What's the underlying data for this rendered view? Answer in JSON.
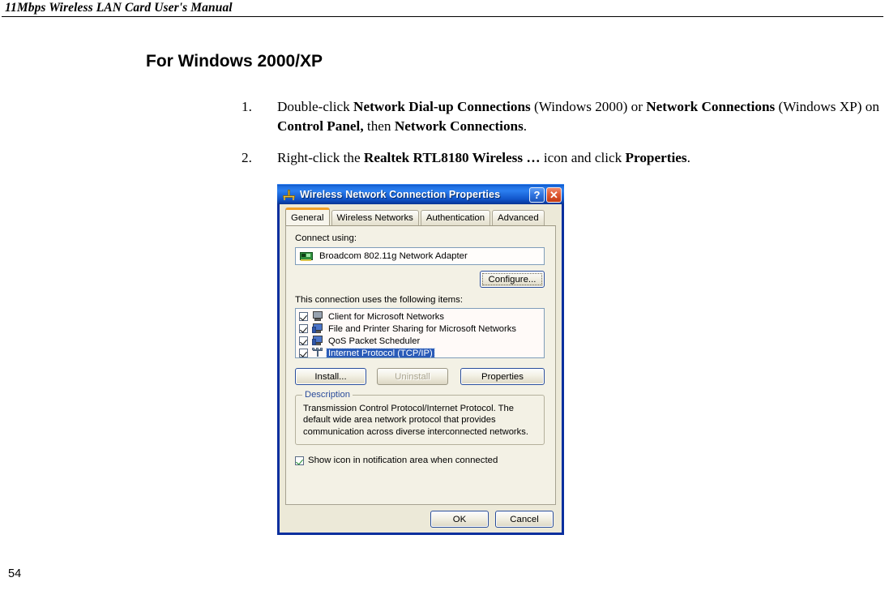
{
  "page": {
    "running_header": "11Mbps Wireless LAN Card User's Manual",
    "page_number": "54",
    "section_heading": "For Windows 2000/XP"
  },
  "steps": [
    {
      "number": "1.",
      "runs": [
        {
          "text": "Double-click ",
          "bold": false
        },
        {
          "text": "Network Dial-up Connections",
          "bold": true
        },
        {
          "text": " (Windows 2000) or ",
          "bold": false
        },
        {
          "text": "Network Connections",
          "bold": true
        },
        {
          "text": " (Windows XP) on ",
          "bold": false
        },
        {
          "text": "Control Panel,",
          "bold": true
        },
        {
          "text": " then ",
          "bold": false
        },
        {
          "text": "Network Connections",
          "bold": true
        },
        {
          "text": ".",
          "bold": false
        }
      ]
    },
    {
      "number": "2.",
      "runs": [
        {
          "text": "Right-click the ",
          "bold": false
        },
        {
          "text": "Realtek RTL8180 Wireless …",
          "bold": true
        },
        {
          "text": " icon and click ",
          "bold": false
        },
        {
          "text": "Properties",
          "bold": true
        },
        {
          "text": ".",
          "bold": false
        }
      ]
    }
  ],
  "dialog": {
    "title": "Wireless Network Connection Properties",
    "title_icon": "network-connection-icon",
    "help_button_label": "?",
    "close_button_label": "✕",
    "tabs": [
      {
        "label": "General",
        "active": true
      },
      {
        "label": "Wireless Networks",
        "active": false
      },
      {
        "label": "Authentication",
        "active": false
      },
      {
        "label": "Advanced",
        "active": false
      }
    ],
    "general": {
      "connect_using_label": "Connect using:",
      "adapter_name": "Broadcom 802.11g Network Adapter",
      "adapter_icon": "network-card-icon",
      "configure_button": "Configure...",
      "items_label": "This connection uses the following items:",
      "items": [
        {
          "label": "Client for Microsoft Networks",
          "checked": true,
          "selected": false,
          "icon": "computer-icon"
        },
        {
          "label": "File and Printer Sharing for Microsoft Networks",
          "checked": true,
          "selected": false,
          "icon": "file-print-sharing-icon"
        },
        {
          "label": "QoS Packet Scheduler",
          "checked": true,
          "selected": false,
          "icon": "qos-scheduler-icon"
        },
        {
          "label": "Internet Protocol (TCP/IP)",
          "checked": true,
          "selected": true,
          "icon": "protocol-icon"
        }
      ],
      "install_button": "Install...",
      "uninstall_button": "Uninstall",
      "properties_button": "Properties",
      "description_legend": "Description",
      "description_text": "Transmission Control Protocol/Internet Protocol. The default wide area network protocol that provides communication across diverse interconnected networks.",
      "show_icon_checkbox_label": "Show icon in notification area when connected",
      "show_icon_checked": true
    },
    "ok_button": "OK",
    "cancel_button": "Cancel"
  },
  "colors": {
    "titlebar_blue": "#1e6fe0",
    "window_border": "#0a2f9e",
    "dialog_face": "#ece9d8",
    "tab_active_accent": "#f2a128",
    "selection_blue": "#2a5bb8",
    "legend_blue": "#2a4b9b"
  }
}
